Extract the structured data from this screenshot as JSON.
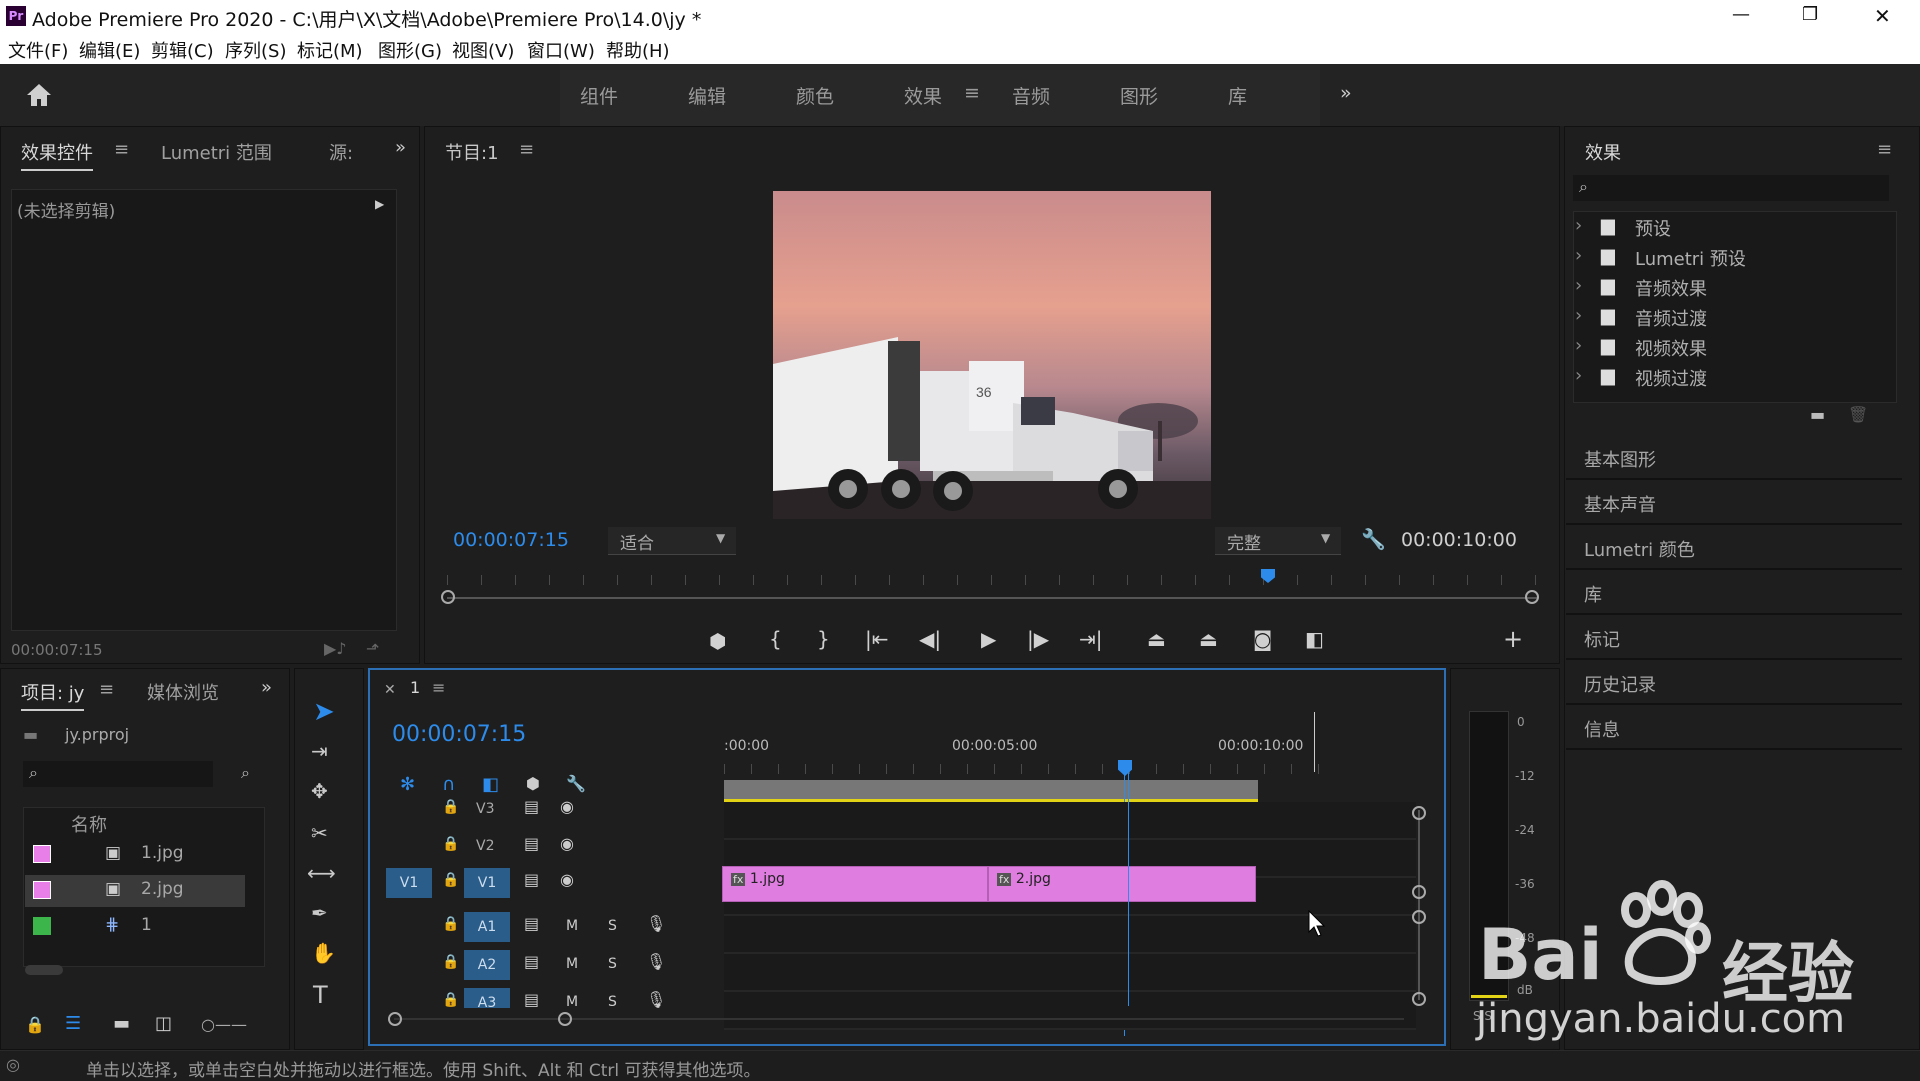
{
  "title_bar": {
    "title": "Adobe Premiere Pro 2020 - C:\\用户\\X\\文档\\Adobe\\Premiere Pro\\14.0\\jy *",
    "app_icon": "Pr",
    "minimize": "—",
    "restore": "❐",
    "close": "✕"
  },
  "menu": [
    "文件(F)",
    "编辑(E)",
    "剪辑(C)",
    "序列(S)",
    "标记(M)",
    "图形(G)",
    "视图(V)",
    "窗口(W)",
    "帮助(H)"
  ],
  "workspaces": {
    "tabs": [
      "组件",
      "编辑",
      "颜色",
      "效果",
      "音频",
      "图形",
      "库"
    ],
    "active": "效果",
    "more": "»"
  },
  "effect_controls": {
    "tabs": [
      "效果控件",
      "Lumetri 范围",
      "源:"
    ],
    "empty_text": "(未选择剪辑)",
    "timecode": "00:00:07:15"
  },
  "program": {
    "title": "节目:1",
    "timecode": "00:00:07:15",
    "fit": "适合",
    "quality": "完整",
    "duration": "00:00:10:00",
    "truck_number": "36",
    "playhead_fraction": 0.75
  },
  "project": {
    "tabs": [
      "项目: jy",
      "媒体浏览"
    ],
    "file": "jy.prproj",
    "column": "名称",
    "items": [
      {
        "name": "1.jpg",
        "color": "#e87fe8"
      },
      {
        "name": "2.jpg",
        "color": "#e87fe8"
      },
      {
        "name": "1",
        "color": "#3cb64b"
      }
    ]
  },
  "timeline": {
    "tab": "1",
    "timecode": "00:00:07:15",
    "ruler": [
      ":00:00",
      "00:00:05:00",
      "00:00:10:00"
    ],
    "video_tracks": [
      "V3",
      "V2",
      "V1"
    ],
    "audio_tracks": [
      "A1",
      "A2",
      "A3"
    ],
    "source_patch": "V1",
    "clips": [
      "1.jpg",
      "2.jpg"
    ],
    "mute": "M",
    "solo": "S"
  },
  "meter": {
    "labels": [
      "0",
      "-12",
      "-24",
      "-36",
      "-48",
      "dB"
    ],
    "bottom": "S S"
  },
  "effects": {
    "title": "效果",
    "folders": [
      "预设",
      "Lumetri 预设",
      "音频效果",
      "音频过渡",
      "视频效果",
      "视频过渡"
    ],
    "sections": [
      "基本图形",
      "基本声音",
      "Lumetri 颜色",
      "库",
      "标记",
      "历史记录",
      "信息"
    ]
  },
  "status": "单击以选择，或单击空白处并拖动以进行框选。使用 Shift、Alt 和 Ctrl 可获得其他选项。",
  "watermark": {
    "brand": "Bai",
    "suffix": "经验",
    "url": "jingyan.baidu.com"
  }
}
